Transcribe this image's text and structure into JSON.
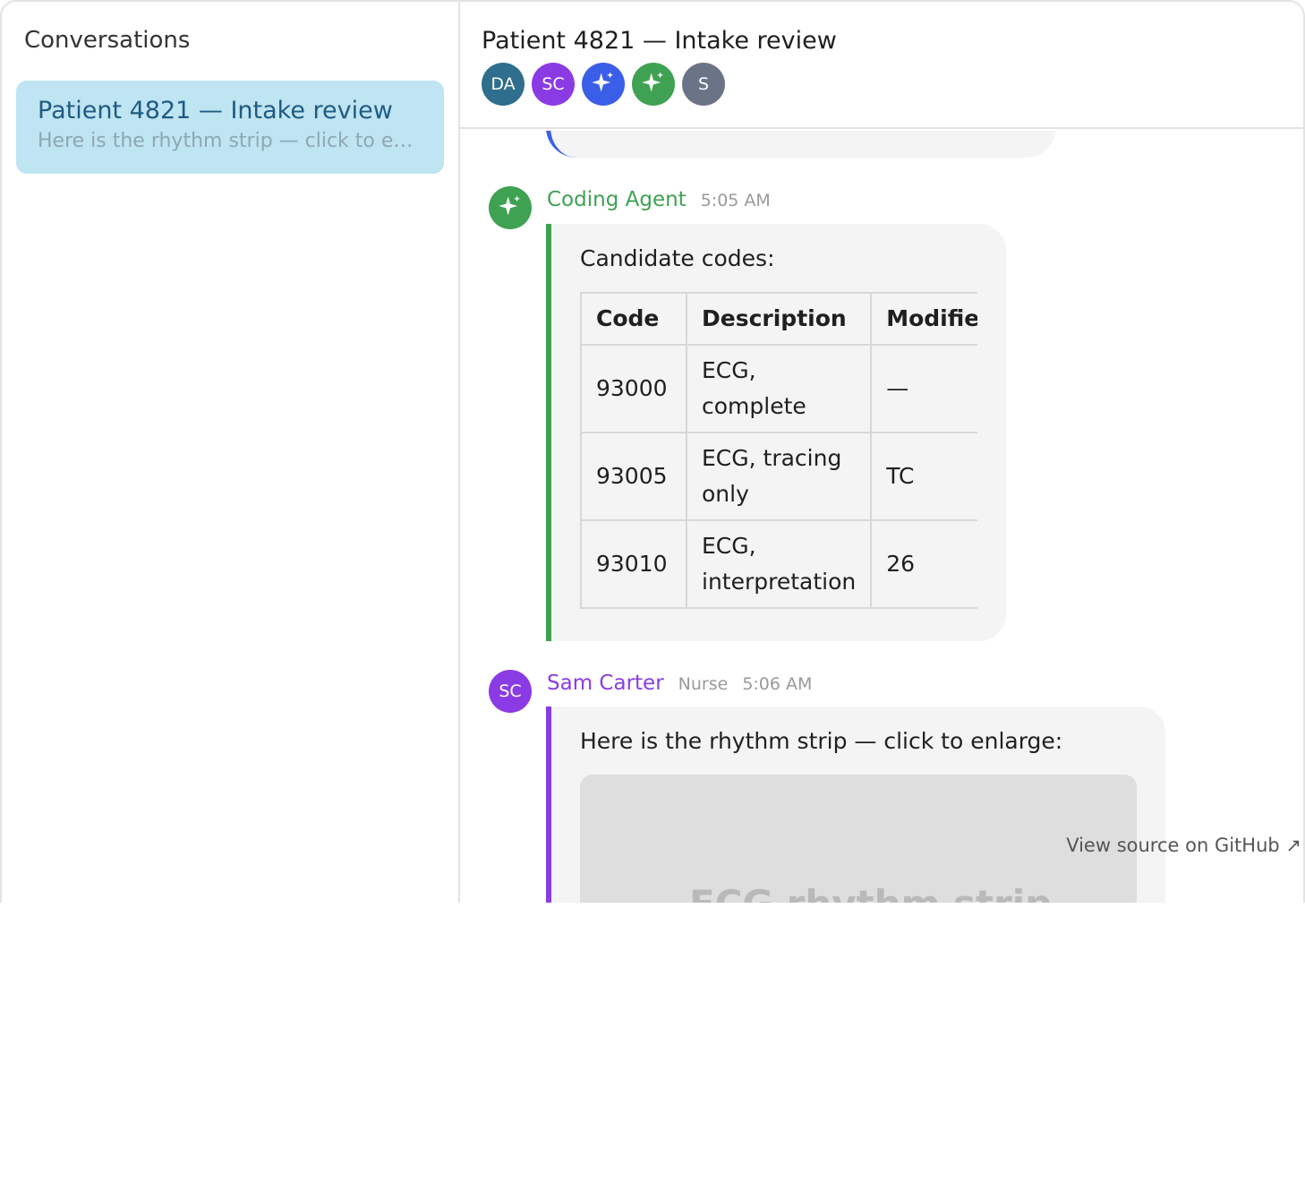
{
  "sidebar": {
    "title": "Conversations",
    "conversations": [
      {
        "title": "Patient 4821 — Intake review",
        "preview": "Here is the rhythm strip — click to enl..."
      }
    ]
  },
  "header": {
    "title": "Patient 4821 — Intake review",
    "participants": [
      {
        "initials": "DA",
        "color": "#2f6e8c"
      },
      {
        "initials": "SC",
        "color": "#8a3be3"
      },
      {
        "initials": "",
        "icon": "sparkle-icon",
        "color": "#3b5ee8"
      },
      {
        "initials": "",
        "icon": "sparkle-icon",
        "color": "#3fa152"
      },
      {
        "initials": "S",
        "color": "#6b7486"
      }
    ]
  },
  "messages": [
    {
      "author": "Coding Agent",
      "time": "5:05 AM",
      "color": "#3fa152",
      "intro": "Candidate codes:",
      "table": {
        "headers": [
          "Code",
          "Description",
          "Modifier"
        ],
        "rows": [
          [
            "93000",
            "ECG, complete",
            "—"
          ],
          [
            "93005",
            "ECG, tracing only",
            "TC"
          ],
          [
            "93010",
            "ECG, interpretation",
            "26"
          ]
        ]
      }
    },
    {
      "author": "Sam Carter",
      "role": "Nurse",
      "time": "5:06 AM",
      "initials": "SC",
      "color": "#8a3be3",
      "text": "Here is the rhythm strip — click to enlarge:",
      "image_label": "ECG rhythm strip"
    }
  ],
  "footer": {
    "github_link": "View source on GitHub ↗"
  }
}
